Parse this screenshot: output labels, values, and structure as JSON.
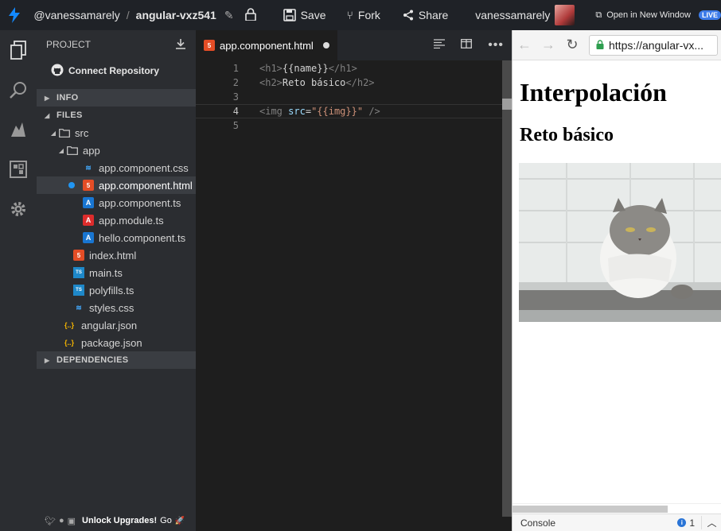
{
  "topbar": {
    "user": "@vanessamarely",
    "separator": "/",
    "project": "angular-vxz541",
    "save": "Save",
    "fork": "Fork",
    "share": "Share",
    "username": "vanessamarely",
    "open_window": "Open in New Window",
    "live_badge": "LIVE"
  },
  "sidebar": {
    "title": "PROJECT",
    "connect": "Connect Repository",
    "sections": {
      "info": "INFO",
      "files": "FILES",
      "dependencies": "DEPENDENCIES"
    },
    "tree": [
      {
        "label": "src",
        "kind": "folder"
      },
      {
        "label": "app",
        "kind": "folder"
      },
      {
        "label": "app.component.css",
        "kind": "css"
      },
      {
        "label": "app.component.html",
        "kind": "html",
        "active": true
      },
      {
        "label": "app.component.ts",
        "kind": "ng"
      },
      {
        "label": "app.module.ts",
        "kind": "ng"
      },
      {
        "label": "hello.component.ts",
        "kind": "ng"
      },
      {
        "label": "index.html",
        "kind": "html"
      },
      {
        "label": "main.ts",
        "kind": "ts"
      },
      {
        "label": "polyfills.ts",
        "kind": "ts"
      },
      {
        "label": "styles.css",
        "kind": "css"
      },
      {
        "label": "angular.json",
        "kind": "json"
      },
      {
        "label": "package.json",
        "kind": "json"
      }
    ],
    "footer": {
      "upgrade": "Unlock Upgrades!",
      "go": "Go"
    }
  },
  "editor": {
    "tab": "app.component.html",
    "line_numbers": [
      "1",
      "2",
      "3",
      "4",
      "5"
    ],
    "lines": {
      "l1": {
        "open": "<h1>",
        "text": "{{name}}",
        "close": "</h1>"
      },
      "l2": {
        "open": "<h2>",
        "text": "Reto básico",
        "close": "</h2>"
      },
      "l4": {
        "tag": "<img",
        "attr": "src",
        "eq": "=",
        "value": "\"{{img}}\"",
        "end": " />"
      }
    }
  },
  "preview": {
    "url": "https://angular-vx...",
    "h1": "Interpolación",
    "h2": "Reto básico",
    "console": "Console",
    "console_count": "1"
  },
  "colors": {
    "accent": "#3d7be8",
    "topbar": "#1f2227",
    "sidebar": "#2b2d31",
    "editor": "#1e1e1e"
  }
}
